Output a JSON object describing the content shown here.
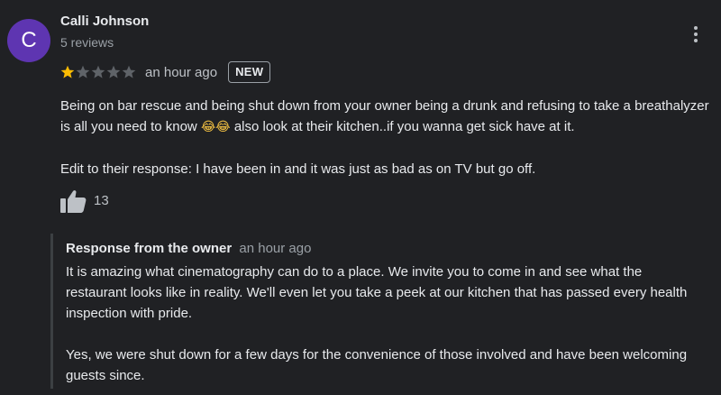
{
  "reviewer": {
    "initial": "C",
    "name": "Calli Johnson",
    "review_count": "5 reviews",
    "avatar_color": "#5e35b1"
  },
  "rating": {
    "stars": 1,
    "max_stars": 5,
    "filled_color": "#fbbc04",
    "empty_color": "#5f6368"
  },
  "review": {
    "time": "an hour ago",
    "badge": "NEW",
    "paragraph_1_a": "Being on bar rescue and being shut down from your owner being a drunk and refusing to take a breathalyzer is all you need to know ",
    "emoji": "😂😂",
    "paragraph_1_b": " also look at their kitchen..if you wanna get sick have at it.",
    "paragraph_2": "Edit to their response: I have been in and it was just as bad as on TV but go off."
  },
  "likes": {
    "count": "13",
    "icon": "thumb-up-icon"
  },
  "menu": {
    "icon": "more-vertical-icon"
  },
  "owner_response": {
    "label": "Response from the owner",
    "time": "an hour ago",
    "paragraph_1": "It is amazing what cinematography can do to a place. We invite you to come in and see what the restaurant looks like in reality. We'll even let you take a peek at our kitchen that has passed every health inspection with pride.",
    "paragraph_2": "Yes, we were shut down for a few days for the convenience of those involved and have been welcoming guests since."
  }
}
